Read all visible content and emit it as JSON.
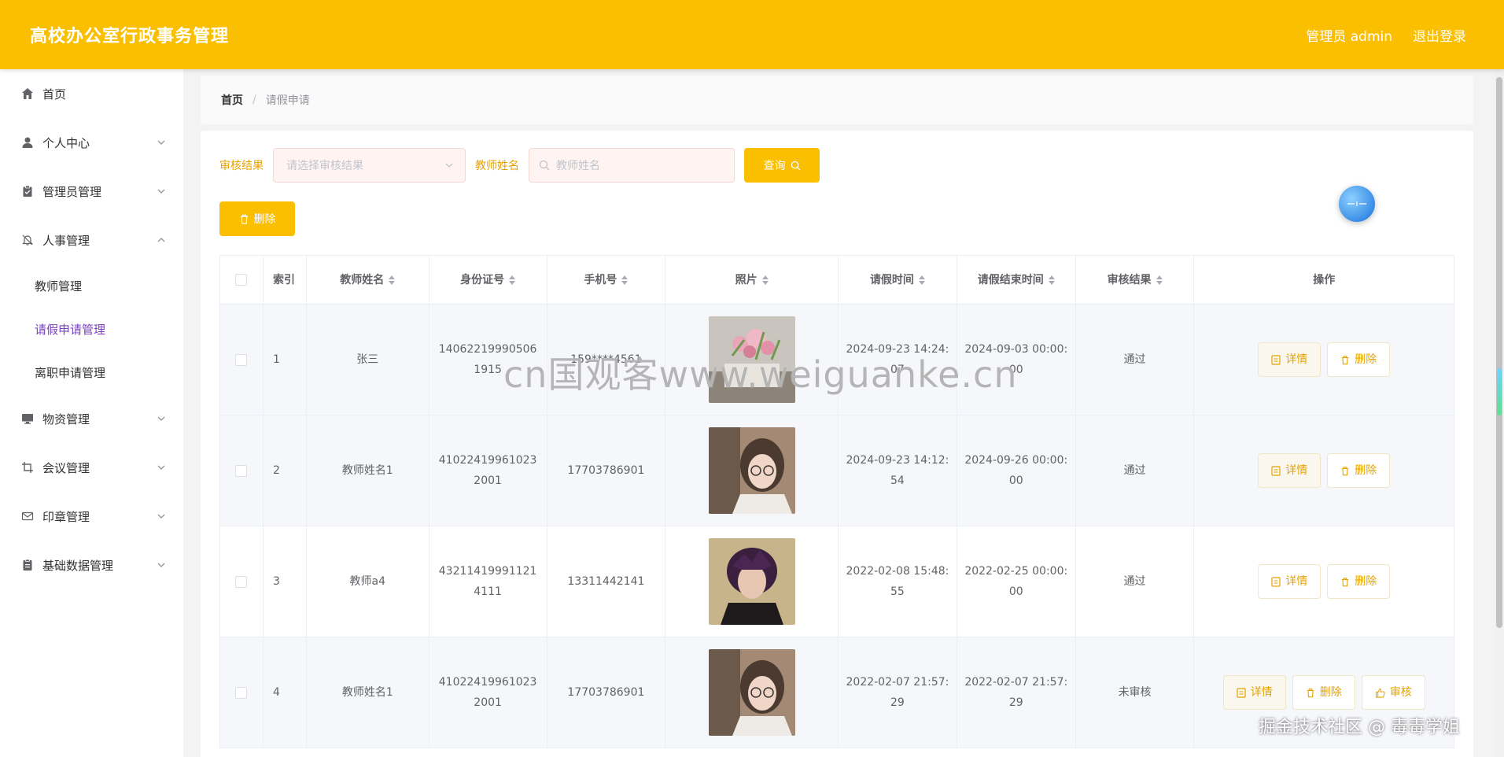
{
  "header": {
    "title": "高校办公室行政事务管理",
    "user": "管理员 admin",
    "logout": "退出登录"
  },
  "sidebar": {
    "items": [
      {
        "label": "首页",
        "icon": "home-icon"
      },
      {
        "label": "个人中心",
        "icon": "user-icon"
      },
      {
        "label": "管理员管理",
        "icon": "clipboard-icon"
      },
      {
        "label": "人事管理",
        "icon": "bell-off-icon",
        "expanded": true,
        "children": [
          "教师管理",
          "请假申请管理",
          "离职申请管理"
        ]
      },
      {
        "label": "物资管理",
        "icon": "monitor-icon"
      },
      {
        "label": "会议管理",
        "icon": "crop-icon"
      },
      {
        "label": "印章管理",
        "icon": "mail-icon"
      },
      {
        "label": "基础数据管理",
        "icon": "document-icon"
      }
    ],
    "active_child": "请假申请管理"
  },
  "breadcrumb": {
    "home": "首页",
    "sep": "/",
    "current": "请假申请"
  },
  "search": {
    "result_label": "审核结果",
    "result_placeholder": "请选择审核结果",
    "name_label": "教师姓名",
    "name_placeholder": "教师姓名",
    "query_button": "查询"
  },
  "toolbar": {
    "delete_button": "删除"
  },
  "table": {
    "headers": {
      "index": "索引",
      "name": "教师姓名",
      "id": "身份证号",
      "phone": "手机号",
      "photo": "照片",
      "start": "请假时间",
      "end": "请假结束时间",
      "result": "审核结果",
      "op": "操作"
    },
    "actions": {
      "detail": "详情",
      "delete": "删除",
      "review": "审核"
    },
    "rows": [
      {
        "index": "1",
        "name": "张三",
        "id": "140622199905061915",
        "phone": "159****4561",
        "start": "2024-09-23 14:24:07",
        "end": "2024-09-03 00:00:00",
        "result": "通过"
      },
      {
        "index": "2",
        "name": "教师姓名1",
        "id": "410224199610232001",
        "phone": "17703786901",
        "start": "2024-09-23 14:12:54",
        "end": "2024-09-26 00:00:00",
        "result": "通过"
      },
      {
        "index": "3",
        "name": "教师a4",
        "id": "432114199911214111",
        "phone": "13311442141",
        "start": "2022-02-08 15:48:55",
        "end": "2022-02-25 00:00:00",
        "result": "通过"
      },
      {
        "index": "4",
        "name": "教师姓名1",
        "id": "410224199610232001",
        "phone": "17703786901",
        "start": "2022-02-07 21:57:29",
        "end": "2022-02-07 21:57:29",
        "result": "未审核"
      }
    ]
  },
  "watermark": "cn国观客www.weiguanke.cn",
  "credit": "掘金技术社区 @ 毒毒学姐",
  "colors": {
    "brand": "#fbbf02",
    "active": "#7b3fbf"
  }
}
